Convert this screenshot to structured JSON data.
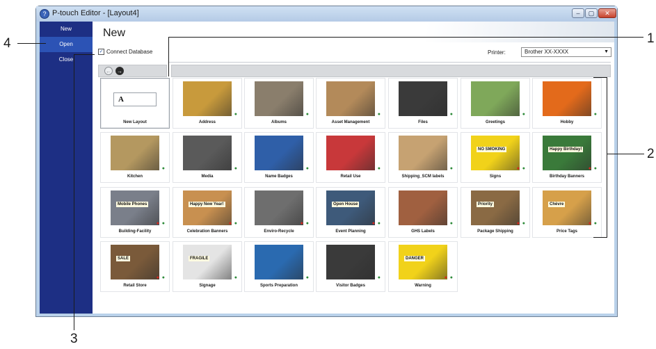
{
  "window": {
    "title": "P-touch Editor - [Layout4]",
    "minimize": "–",
    "maximize": "▢",
    "close": "✕",
    "app_icon": "?"
  },
  "nav": {
    "items": [
      "New",
      "Open",
      "Close"
    ]
  },
  "page": {
    "heading": "New",
    "connect_database": "Connect Database",
    "printer_label": "Printer:",
    "printer_value": "Brother XX-XXXX"
  },
  "toolbar": {
    "back": "←",
    "forward": "→"
  },
  "templates": [
    {
      "label": "New Layout",
      "color": "#ffffff",
      "selected": true,
      "overlay": "A"
    },
    {
      "label": "Address",
      "color": "#c89a3c"
    },
    {
      "label": "Albums",
      "color": "#8a7e6c"
    },
    {
      "label": "Asset Management",
      "color": "#b38a5a"
    },
    {
      "label": "Files",
      "color": "#3a3a3a"
    },
    {
      "label": "Greetings",
      "color": "#7fa85a"
    },
    {
      "label": "Hobby",
      "color": "#e36a1b"
    },
    {
      "label": "Kitchen",
      "color": "#b49860"
    },
    {
      "label": "Media",
      "color": "#5a5a5a"
    },
    {
      "label": "Name Badges",
      "color": "#2f5fa8"
    },
    {
      "label": "Retail Use",
      "color": "#c8383a"
    },
    {
      "label": "Shipping_SCM labels",
      "color": "#c6a272"
    },
    {
      "label": "Signs",
      "color": "#f1d21a",
      "overlay": "NO SMOKING"
    },
    {
      "label": "Birthday Banners",
      "color": "#3a7a3a",
      "overlay": "Happy Birthday!"
    },
    {
      "label": "Building-Facility",
      "color": "#7a7f8a",
      "overlay": "Mobile Phones"
    },
    {
      "label": "Celebration Banners",
      "color": "#c89050",
      "overlay": "Happy New Year!"
    },
    {
      "label": "Enviro-Recycle",
      "color": "#6e6e6e"
    },
    {
      "label": "Event Planning",
      "color": "#3e5a7a",
      "overlay": "Open House"
    },
    {
      "label": "GHS Labels",
      "color": "#a06040"
    },
    {
      "label": "Package Shipping",
      "color": "#8a6a44",
      "overlay": "Priority"
    },
    {
      "label": "Price Tags",
      "color": "#d6a04a",
      "overlay": "Chèvre"
    },
    {
      "label": "Retail Store",
      "color": "#7a5a3a",
      "overlay": "SALE"
    },
    {
      "label": "Signage",
      "color": "#e4e4e4",
      "overlay": "FRAGILE"
    },
    {
      "label": "Sports Preparation",
      "color": "#2a6ab0"
    },
    {
      "label": "Visitor Badges",
      "color": "#3a3a3a"
    },
    {
      "label": "Warning",
      "color": "#f1d21a",
      "overlay": "DANGER"
    }
  ],
  "callouts": [
    "1",
    "2",
    "3",
    "4"
  ]
}
